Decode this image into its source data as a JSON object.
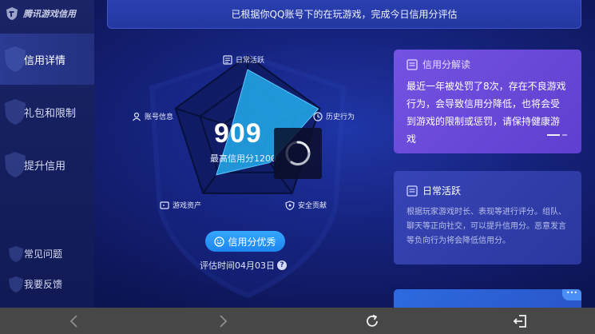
{
  "app": {
    "logo_text": "腾讯游戏信用"
  },
  "sidebar": {
    "items": [
      {
        "label": "信用详情",
        "active": true
      },
      {
        "label": "礼包和限制",
        "active": false
      },
      {
        "label": "提升信用",
        "active": false
      }
    ],
    "bottom_items": [
      {
        "label": "常见问题"
      },
      {
        "label": "我要反馈"
      }
    ]
  },
  "banner": {
    "text": "已根据你QQ账号下的在玩游戏，完成今日信用分评估"
  },
  "radar": {
    "axes": [
      {
        "label": "日常活跃",
        "icon": "document-icon",
        "value": 0.82
      },
      {
        "label": "历史行为",
        "icon": "clock-icon",
        "value": 0.98
      },
      {
        "label": "安全贡献",
        "icon": "shield-icon",
        "value": 0.5
      },
      {
        "label": "游戏资产",
        "icon": "wallet-icon",
        "value": 0.7
      },
      {
        "label": "账号信息",
        "icon": "user-icon",
        "value": 0.22
      }
    ]
  },
  "score": {
    "value": "909",
    "max_label": "最高信用分1200"
  },
  "grade": {
    "label": "信用分优秀",
    "icon": "smile-icon"
  },
  "eval": {
    "time_label": "评估时间04月03日",
    "help_glyph": "?"
  },
  "cards": {
    "interpretation": {
      "title": "信用分解读",
      "body": "最近一年被处罚了8次，存在不良游戏行为，会导致信用分降低，也将会受到游戏的限制或惩罚，请保持健康游戏"
    },
    "daily": {
      "title": "日常活跃",
      "body": "根据玩家游戏时长、表现等进行评分。组队、聊天等正向社交，可以提升信用分。恶意发言等负向行为将会降低信用分。"
    }
  },
  "colors": {
    "accent": "#1c86ee",
    "radar_fill": "#22a4e6",
    "card_purple": "#6a4ad9"
  }
}
